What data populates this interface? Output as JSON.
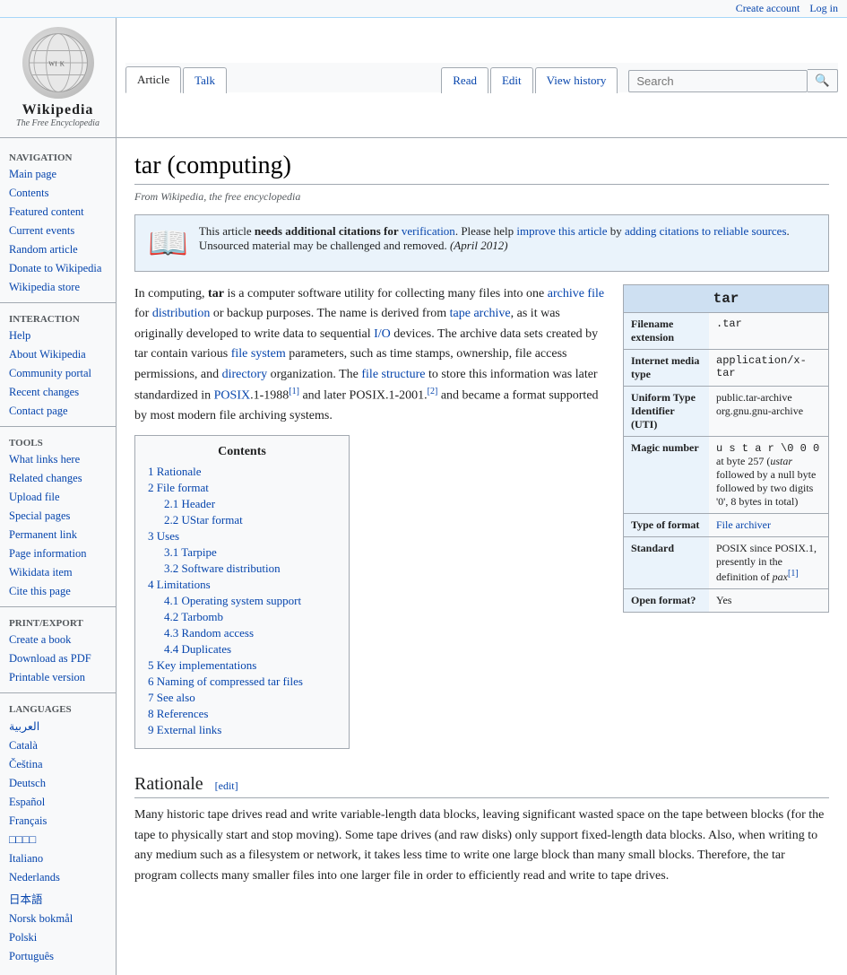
{
  "topbar": {
    "create_account": "Create account",
    "log_in": "Log in"
  },
  "tabs": {
    "article": "Article",
    "talk": "Talk",
    "read": "Read",
    "edit": "Edit",
    "view_history": "View history"
  },
  "search": {
    "placeholder": "Search",
    "button_label": "🔍"
  },
  "logo": {
    "title": "Wikipedia",
    "subtitle": "The Free Encyclopedia"
  },
  "sidebar": {
    "nav_title": "Navigation",
    "nav_items": [
      {
        "label": "Main page",
        "id": "main-page"
      },
      {
        "label": "Contents",
        "id": "contents"
      },
      {
        "label": "Featured content",
        "id": "featured-content"
      },
      {
        "label": "Current events",
        "id": "current-events"
      },
      {
        "label": "Random article",
        "id": "random-article"
      },
      {
        "label": "Donate to Wikipedia",
        "id": "donate"
      },
      {
        "label": "Wikipedia store",
        "id": "wiki-store"
      }
    ],
    "interaction_title": "Interaction",
    "interaction_items": [
      {
        "label": "Help",
        "id": "help"
      },
      {
        "label": "About Wikipedia",
        "id": "about"
      },
      {
        "label": "Community portal",
        "id": "community-portal"
      },
      {
        "label": "Recent changes",
        "id": "recent-changes"
      },
      {
        "label": "Contact page",
        "id": "contact"
      }
    ],
    "tools_title": "Tools",
    "tools_items": [
      {
        "label": "What links here",
        "id": "what-links"
      },
      {
        "label": "Related changes",
        "id": "related-changes"
      },
      {
        "label": "Upload file",
        "id": "upload-file"
      },
      {
        "label": "Special pages",
        "id": "special-pages"
      },
      {
        "label": "Permanent link",
        "id": "permanent-link"
      },
      {
        "label": "Page information",
        "id": "page-info"
      },
      {
        "label": "Wikidata item",
        "id": "wikidata"
      },
      {
        "label": "Cite this page",
        "id": "cite-page"
      }
    ],
    "print_title": "Print/export",
    "print_items": [
      {
        "label": "Create a book",
        "id": "create-book"
      },
      {
        "label": "Download as PDF",
        "id": "download-pdf"
      },
      {
        "label": "Printable version",
        "id": "printable"
      }
    ],
    "languages_title": "Languages",
    "language_items": [
      {
        "label": "العربية",
        "id": "ar"
      },
      {
        "label": "Català",
        "id": "ca"
      },
      {
        "label": "Čeština",
        "id": "cs"
      },
      {
        "label": "Deutsch",
        "id": "de"
      },
      {
        "label": "Español",
        "id": "es"
      },
      {
        "label": "Français",
        "id": "fr"
      },
      {
        "label": "□□□□",
        "id": "other1"
      },
      {
        "label": "Italiano",
        "id": "it"
      },
      {
        "label": "Nederlands",
        "id": "nl"
      },
      {
        "label": "日本語",
        "id": "ja"
      },
      {
        "label": "Norsk bokmål",
        "id": "nb"
      },
      {
        "label": "Polski",
        "id": "pl"
      },
      {
        "label": "Português",
        "id": "pt"
      }
    ]
  },
  "page": {
    "title": "tar (computing)",
    "subtitle": "From Wikipedia, the free encyclopedia"
  },
  "citation_box": {
    "icon": "📖",
    "text_before_bold": "This article ",
    "bold_text": "needs additional citations for",
    "linked_text": "verification",
    "text_after_link": ". Please help ",
    "improve_link": "improve this article",
    "text_mid": " by ",
    "citations_link": "adding citations to reliable sources",
    "text_end": ". Unsourced material may be challenged and removed.",
    "date": "(April 2012)"
  },
  "infobox": {
    "title": "tar",
    "rows": [
      {
        "label": "Filename extension",
        "value": ".tar"
      },
      {
        "label": "Internet media type",
        "value": "application/x-tar"
      },
      {
        "label": "Uniform Type Identifier (UTI)",
        "value": "public.tar-archive org.gnu.gnu-archive"
      },
      {
        "label": "Magic number",
        "value": "u s t a r \\0 0 0 at byte 257 (ustar followed by a null byte followed by two digits '0', 8 bytes in total)"
      },
      {
        "label": "Type of format",
        "value": "File archiver",
        "link": true
      },
      {
        "label": "Standard",
        "value": "POSIX since POSIX.1, presently in the definition of pax[1]"
      },
      {
        "label": "Open format?",
        "value": "Yes"
      }
    ]
  },
  "contents": {
    "title": "Contents",
    "items": [
      {
        "num": "1",
        "label": "Rationale",
        "anchor": "#Rationale"
      },
      {
        "num": "2",
        "label": "File format",
        "anchor": "#File_format",
        "subitems": [
          {
            "num": "2.1",
            "label": "Header",
            "anchor": "#Header"
          },
          {
            "num": "2.2",
            "label": "UStar format",
            "anchor": "#UStar_format"
          }
        ]
      },
      {
        "num": "3",
        "label": "Uses",
        "anchor": "#Uses",
        "subitems": [
          {
            "num": "3.1",
            "label": "Tarpipe",
            "anchor": "#Tarpipe"
          },
          {
            "num": "3.2",
            "label": "Software distribution",
            "anchor": "#Software_distribution"
          }
        ]
      },
      {
        "num": "4",
        "label": "Limitations",
        "anchor": "#Limitations",
        "subitems": [
          {
            "num": "4.1",
            "label": "Operating system support",
            "anchor": "#Operating_system_support"
          },
          {
            "num": "4.2",
            "label": "Tarbomb",
            "anchor": "#Tarbomb"
          },
          {
            "num": "4.3",
            "label": "Random access",
            "anchor": "#Random_access"
          },
          {
            "num": "4.4",
            "label": "Duplicates",
            "anchor": "#Duplicates"
          }
        ]
      },
      {
        "num": "5",
        "label": "Key implementations",
        "anchor": "#Key_implementations"
      },
      {
        "num": "6",
        "label": "Naming of compressed tar files",
        "anchor": "#Naming"
      },
      {
        "num": "7",
        "label": "See also",
        "anchor": "#See_also"
      },
      {
        "num": "8",
        "label": "References",
        "anchor": "#References"
      },
      {
        "num": "9",
        "label": "External links",
        "anchor": "#External_links"
      }
    ]
  },
  "intro_text": {
    "part1": "In computing, ",
    "tar_bold": "tar",
    "part2": " is a computer software utility for collecting many files into one ",
    "archive_link": "archive file",
    "part3": " for ",
    "distribution_link": "distribution",
    "part4": " or backup purposes. The name is derived from ",
    "tape_link": "tape archive",
    "part5": ", as it was originally developed to write data to sequential ",
    "io_link": "I/O",
    "part6": " devices. The archive data sets created by tar contain various ",
    "filesystem_link": "file system",
    "part7": " parameters, such as time stamps, ownership, file access permissions, and ",
    "directory_link": "directory",
    "part8": " organization. The ",
    "file_structure_link": "file structure",
    "part9": " to store this information was later standardized in ",
    "posix_link": "POSIX",
    "part10": ".1-1988",
    "ref1": "[1]",
    "part11": " and later POSIX.1-2001.",
    "ref2": "[2]",
    "part12": " and became a format supported by most modern file archiving systems."
  },
  "rationale_section": {
    "heading": "Rationale",
    "edit_label": "[edit]",
    "text1": "Many historic tape drives read and write variable-length data blocks, leaving significant wasted space on the tape between blocks (for the tape to physically start and stop moving). Some tape drives (and raw disks) only support fixed-length data blocks. Also, when writing to any medium such as a filesystem or network, it takes less time to write one large block than many small blocks. Therefore, the tar program collects many smaller files into one larger file in order to efficiently read and write to tape drives."
  }
}
